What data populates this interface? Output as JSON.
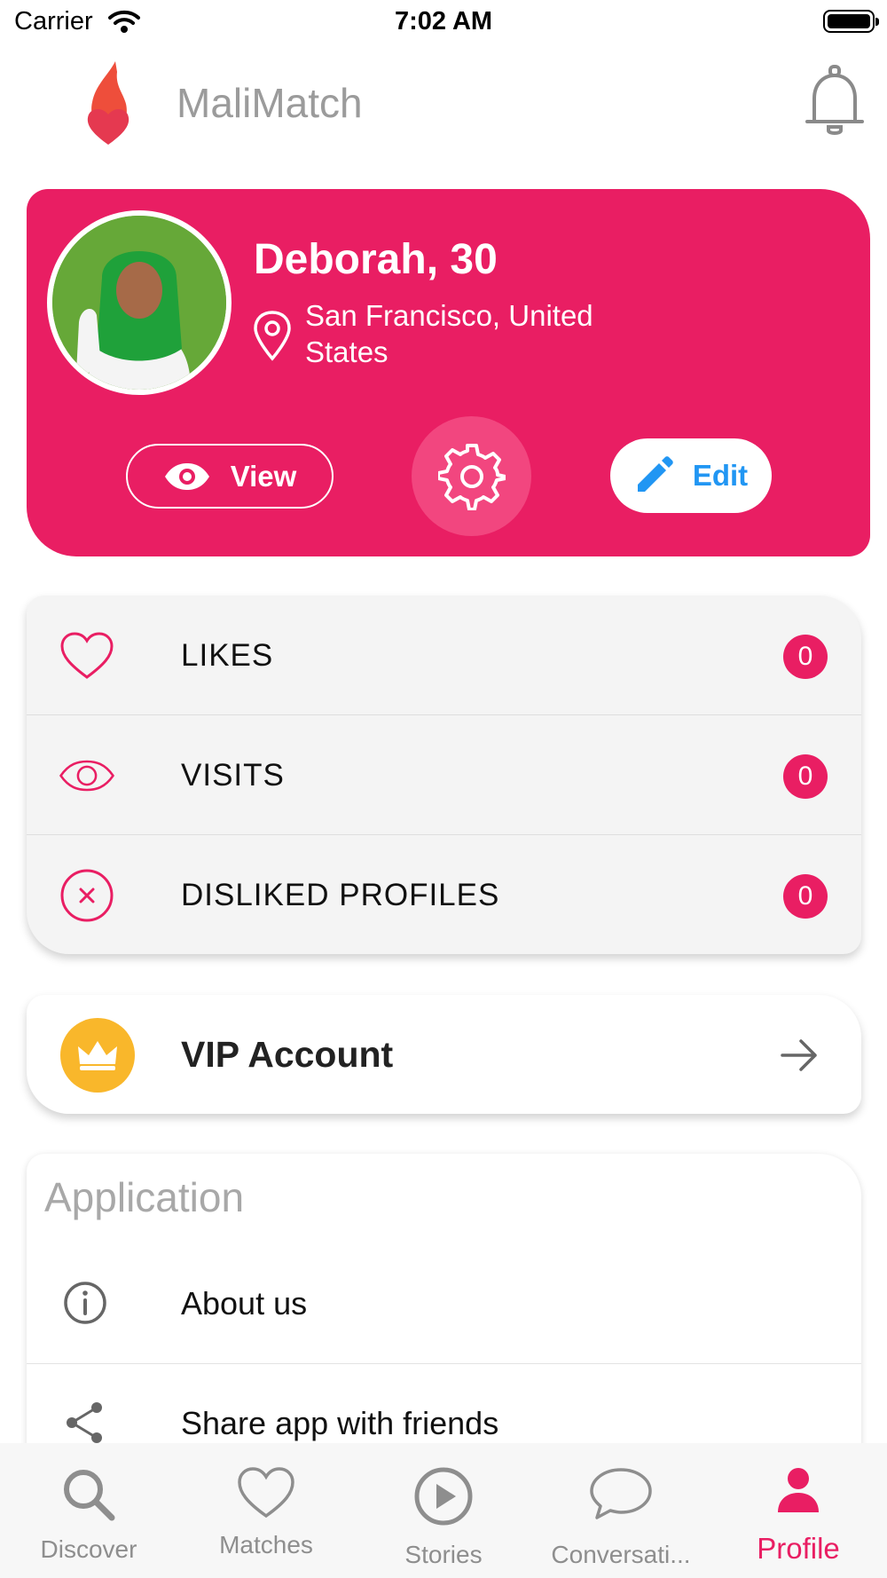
{
  "status_bar": {
    "carrier": "Carrier",
    "time": "7:02 AM"
  },
  "header": {
    "title": "MaliMatch"
  },
  "profile": {
    "name": "Deborah, 30",
    "location": "San Francisco, United States",
    "view_label": "View",
    "edit_label": "Edit"
  },
  "stats": [
    {
      "label": "LIKES",
      "count": "0",
      "icon": "heart-outline-icon"
    },
    {
      "label": "VISITS",
      "count": "0",
      "icon": "eye-outline-icon"
    },
    {
      "label": "DISLIKED PROFILES",
      "count": "0",
      "icon": "close-circle-icon"
    }
  ],
  "vip": {
    "label": "VIP Account",
    "icon": "crown-icon"
  },
  "application": {
    "title": "Application",
    "items": [
      {
        "label": "About us",
        "icon": "info-icon"
      },
      {
        "label": "Share app with friends",
        "icon": "share-icon"
      }
    ]
  },
  "tabs": [
    {
      "label": "Discover",
      "icon": "search-icon",
      "active": false
    },
    {
      "label": "Matches",
      "icon": "heart-icon",
      "active": false
    },
    {
      "label": "Stories",
      "icon": "play-icon",
      "active": false
    },
    {
      "label": "Conversati...",
      "icon": "chat-bubble-icon",
      "active": false
    },
    {
      "label": "Profile",
      "icon": "person-icon",
      "active": true
    }
  ],
  "colors": {
    "accent": "#e91e63",
    "edit_blue": "#2196f3",
    "vip_gold": "#f9b72b",
    "tab_inactive": "#8e8e8e"
  }
}
